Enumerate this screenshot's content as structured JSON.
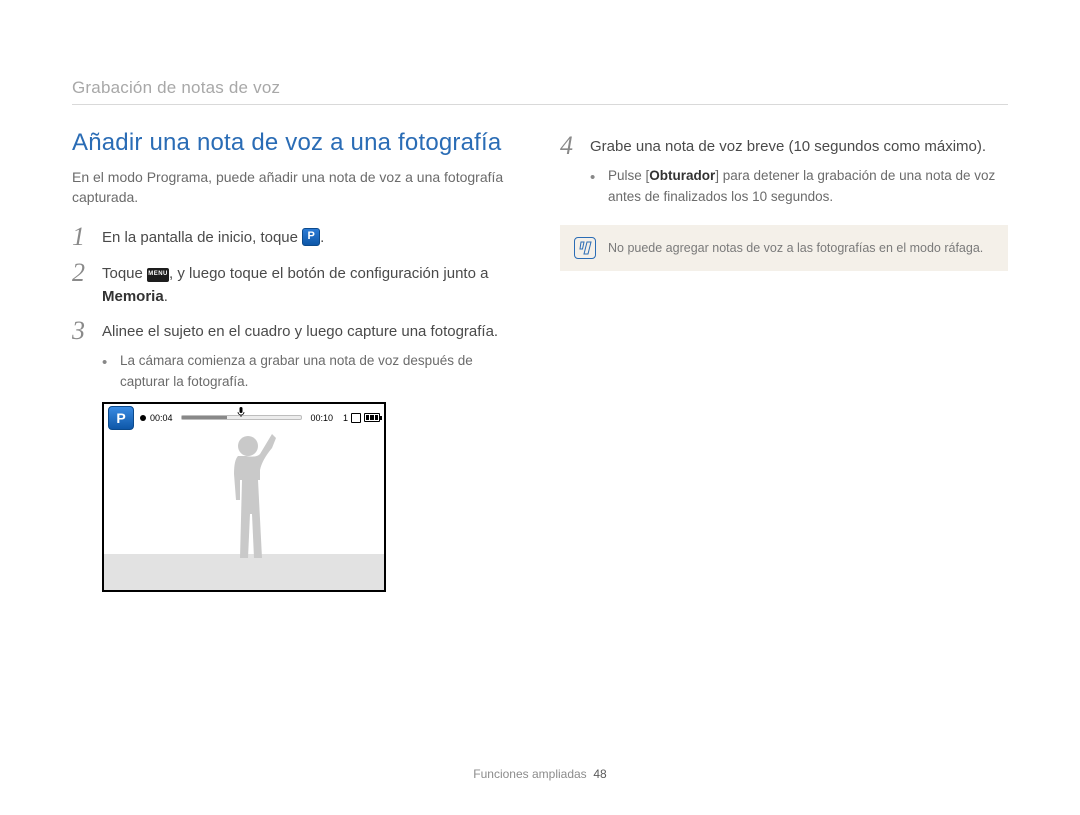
{
  "breadcrumb": "Grabación de notas de voz",
  "title": "Añadir una nota de voz a una fotografía",
  "intro": "En el modo Programa, puede añadir una nota de voz a una fotografía capturada.",
  "steps": {
    "s1": {
      "num": "1",
      "pre": "En la pantalla de inicio, toque ",
      "post": "."
    },
    "s2": {
      "num": "2",
      "pre": "Toque ",
      "mid": ", y luego toque el botón de configuración junto a ",
      "bold": "Memoria",
      "post": "."
    },
    "s3": {
      "num": "3",
      "text": "Alinee el sujeto en el cuadro y luego capture una fotografía.",
      "sub": "La cámara comienza a grabar una nota de voz después de capturar la fotografía."
    },
    "s4": {
      "num": "4",
      "text": "Grabe una nota de voz breve (10 segundos como máximo).",
      "sub_pre": "Pulse [",
      "sub_bold": "Obturador",
      "sub_post": "] para detener la grabación de una nota de voz antes de finalizados los 10 segundos."
    }
  },
  "camera": {
    "mode_label": "P",
    "time_elapsed": "00:04",
    "time_total": "00:10",
    "shots_remaining": "1"
  },
  "note": "No puede agregar notas de voz a las fotografías en el modo ráfaga.",
  "footer_section": "Funciones ampliadas",
  "footer_page": "48",
  "chart_data": {
    "type": "table",
    "title": "Voice memo recording indicator",
    "elapsed_seconds": 4,
    "total_seconds": 10,
    "progress_ratio": 0.4,
    "shots_remaining": 1
  }
}
